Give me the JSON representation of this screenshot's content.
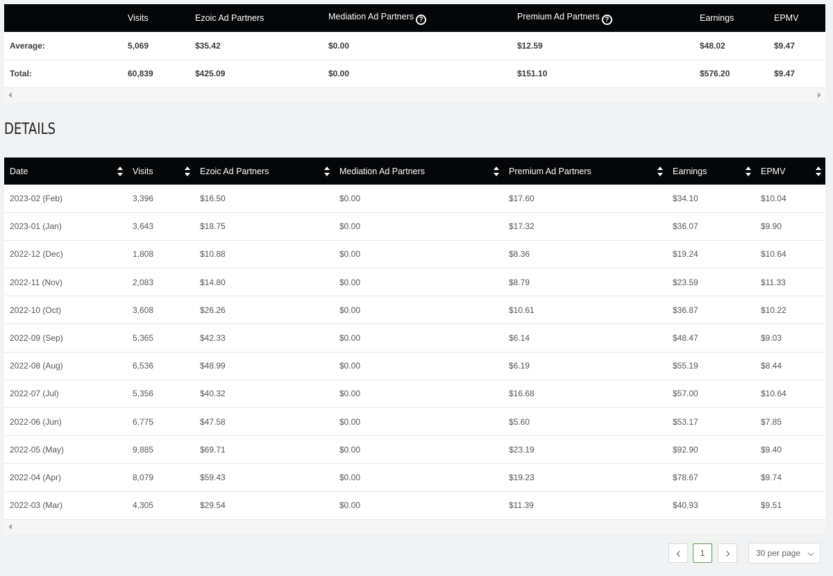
{
  "summary": {
    "headers": [
      "",
      "Visits",
      "Ezoic Ad Partners",
      "Mediation Ad Partners",
      "Premium Ad Partners",
      "Earnings",
      "EPMV"
    ],
    "rows": [
      {
        "label": "Average:",
        "values": [
          "5,069",
          "$35.42",
          "$0.00",
          "$12.59",
          "$48.02",
          "$9.47"
        ]
      },
      {
        "label": "Total:",
        "values": [
          "60,839",
          "$425.09",
          "$0.00",
          "$151.10",
          "$576.20",
          "$9.47"
        ]
      }
    ]
  },
  "details": {
    "title": "DETAILS",
    "headers": [
      "Date",
      "Visits",
      "Ezoic Ad Partners",
      "Mediation Ad Partners",
      "Premium Ad Partners",
      "Earnings",
      "EPMV"
    ],
    "rows": [
      [
        "2023-02 (Feb)",
        "3,396",
        "$16.50",
        "$0.00",
        "$17.60",
        "$34.10",
        "$10.04"
      ],
      [
        "2023-01 (Jan)",
        "3,643",
        "$18.75",
        "$0.00",
        "$17.32",
        "$36.07",
        "$9.90"
      ],
      [
        "2022-12 (Dec)",
        "1,808",
        "$10.88",
        "$0.00",
        "$8.36",
        "$19.24",
        "$10.64"
      ],
      [
        "2022-11 (Nov)",
        "2,083",
        "$14.80",
        "$0.00",
        "$8.79",
        "$23.59",
        "$11.33"
      ],
      [
        "2022-10 (Oct)",
        "3,608",
        "$26.26",
        "$0.00",
        "$10.61",
        "$36.87",
        "$10.22"
      ],
      [
        "2022-09 (Sep)",
        "5,365",
        "$42.33",
        "$0.00",
        "$6.14",
        "$48.47",
        "$9.03"
      ],
      [
        "2022-08 (Aug)",
        "6,536",
        "$48.99",
        "$0.00",
        "$6.19",
        "$55.19",
        "$8.44"
      ],
      [
        "2022-07 (Jul)",
        "5,356",
        "$40.32",
        "$0.00",
        "$16.68",
        "$57.00",
        "$10.64"
      ],
      [
        "2022-06 (Jun)",
        "6,775",
        "$47.58",
        "$0.00",
        "$5.60",
        "$53.17",
        "$7.85"
      ],
      [
        "2022-05 (May)",
        "9,885",
        "$69.71",
        "$0.00",
        "$23.19",
        "$92.90",
        "$9.40"
      ],
      [
        "2022-04 (Apr)",
        "8,079",
        "$59.43",
        "$0.00",
        "$19.23",
        "$78.67",
        "$9.74"
      ],
      [
        "2022-03 (Mar)",
        "4,305",
        "$29.54",
        "$0.00",
        "$11.39",
        "$40.93",
        "$9.51"
      ]
    ]
  },
  "pagination": {
    "current_page": "1",
    "per_page": "30 per page"
  },
  "colors": {
    "header_bg": "#050608",
    "page_bg": "#f1f2f4",
    "active_page_border": "#5a9e4a"
  },
  "icons": [
    "help-circle-icon",
    "sort-icon",
    "chevron-left-icon",
    "chevron-right-icon",
    "chevron-down-icon"
  ]
}
